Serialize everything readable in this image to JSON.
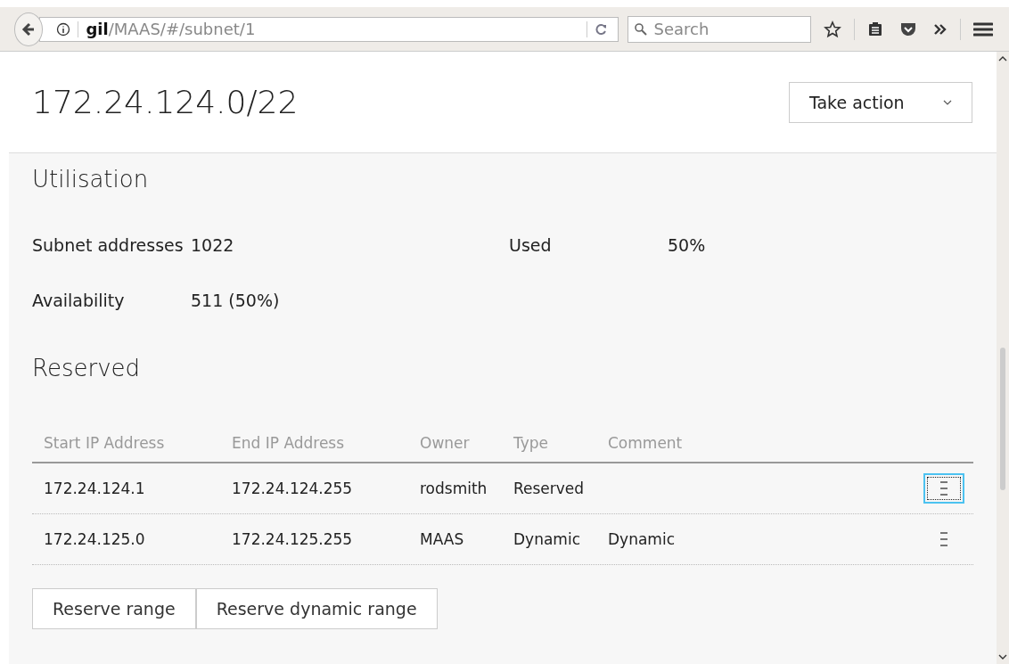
{
  "browser": {
    "url": "**gil**/MAAS/#/subnet/1",
    "search": {
      "placeholder": "Search"
    }
  },
  "header": {
    "title": "172.24.124.0/22",
    "action": "Take action"
  },
  "utilisation": {
    "title": "Utilisation",
    "stats": [
      {
        "label": "Subnet addresses",
        "value": "1022"
      },
      {
        "label": "Used",
        "value": "50%"
      },
      {
        "label": "Availability",
        "value": "511 (50%)"
      }
    ]
  },
  "reserved": {
    "title": "Reserved",
    "columns": [
      "Start IP Address",
      "End IP Address",
      "Owner",
      "Type",
      "Comment"
    ],
    "rows": [
      {
        "cells": [
          "172.24.124.1",
          "172.24.124.255",
          "rodsmith",
          "Reserved",
          ""
        ],
        "focused": true
      },
      {
        "cells": [
          "172.24.125.0",
          "172.24.125.255",
          "MAAS",
          "Dynamic",
          "Dynamic"
        ],
        "focused": false
      }
    ],
    "buttons": [
      "Reserve range",
      "Reserve dynamic range"
    ]
  }
}
